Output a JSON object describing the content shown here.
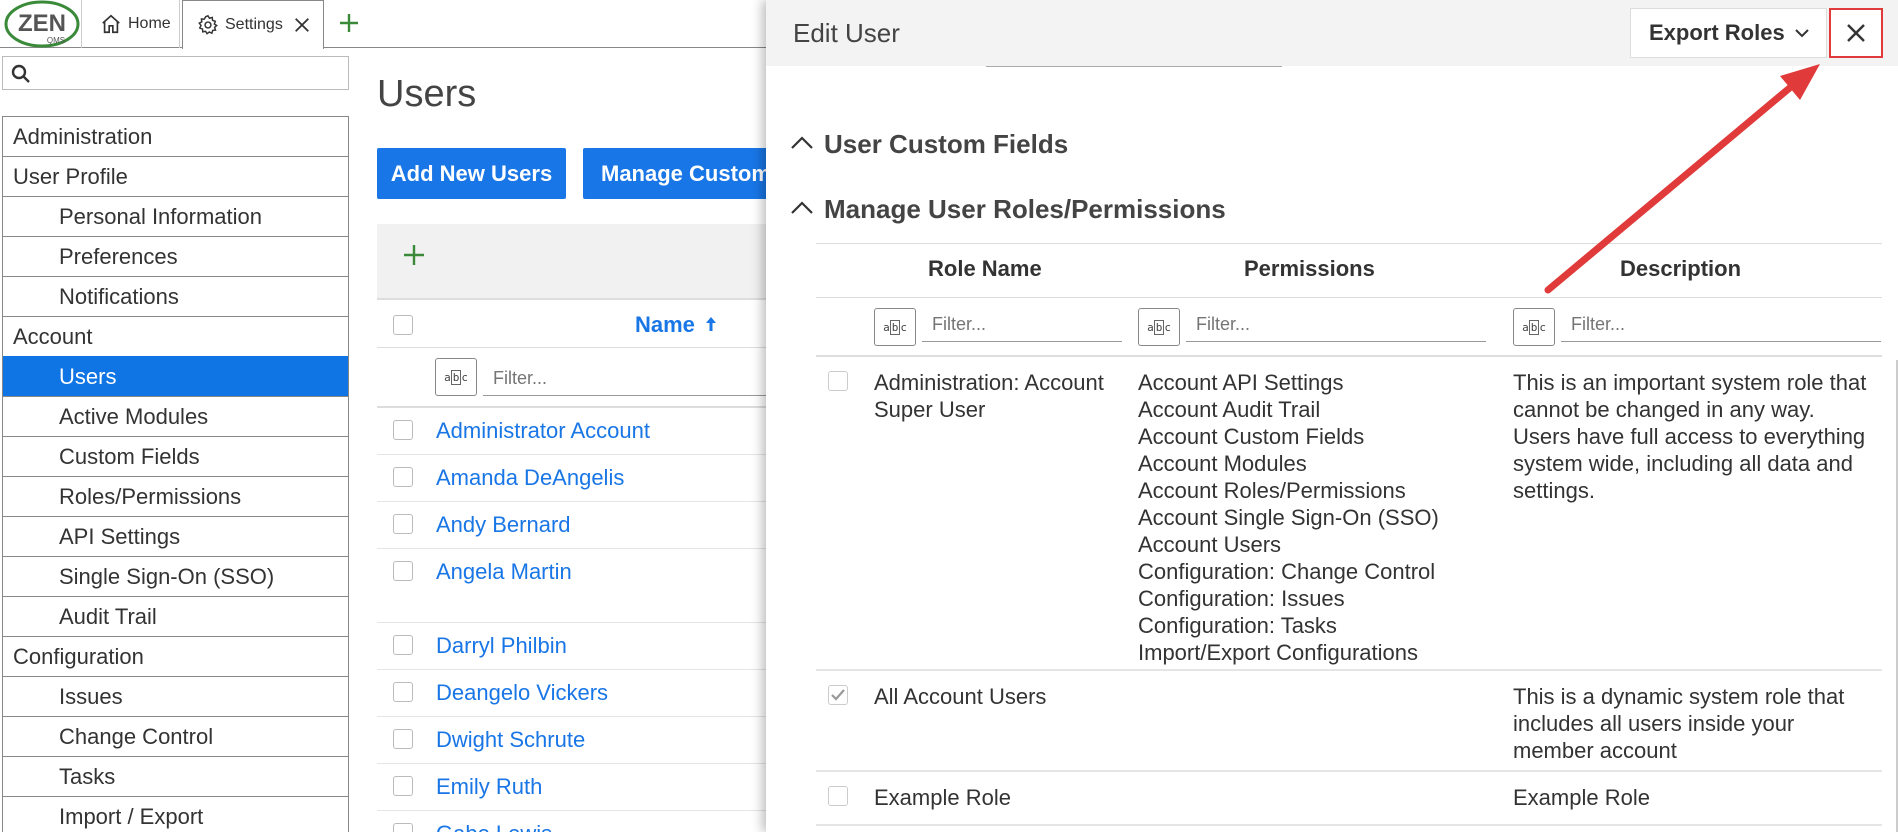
{
  "app": {
    "logo_text": "ZEN",
    "logo_sub": "QMS",
    "tabs": [
      {
        "label": "Home",
        "icon": "home-icon"
      },
      {
        "label": "Settings",
        "icon": "gear-icon"
      }
    ]
  },
  "sidebar": {
    "search_placeholder": "",
    "items": [
      {
        "label": "Administration",
        "level": "section"
      },
      {
        "label": "User Profile",
        "level": "section"
      },
      {
        "label": "Personal Information",
        "level": "child"
      },
      {
        "label": "Preferences",
        "level": "child"
      },
      {
        "label": "Notifications",
        "level": "child"
      },
      {
        "label": "Account",
        "level": "section"
      },
      {
        "label": "Users",
        "level": "child",
        "active": true
      },
      {
        "label": "Active Modules",
        "level": "child"
      },
      {
        "label": "Custom Fields",
        "level": "child"
      },
      {
        "label": "Roles/Permissions",
        "level": "child"
      },
      {
        "label": "API Settings",
        "level": "child"
      },
      {
        "label": "Single Sign-On (SSO)",
        "level": "child"
      },
      {
        "label": "Audit Trail",
        "level": "child"
      },
      {
        "label": "Configuration",
        "level": "section"
      },
      {
        "label": "Issues",
        "level": "child"
      },
      {
        "label": "Change Control",
        "level": "child"
      },
      {
        "label": "Tasks",
        "level": "child"
      },
      {
        "label": "Import / Export",
        "level": "child"
      }
    ]
  },
  "users_page": {
    "title": "Users",
    "add_button": "Add New Users",
    "manage_button": "Manage Custom",
    "name_column": "Name",
    "filter_placeholder": "Filter...",
    "users": [
      "Administrator Account",
      "Amanda DeAngelis",
      "Andy Bernard",
      "Angela Martin",
      "Darryl Philbin",
      "Deangelo Vickers",
      "Dwight Schrute",
      "Emily Ruth",
      "Gabe Lewis"
    ]
  },
  "edit_panel": {
    "title": "Edit User",
    "export_label": "Export Roles",
    "sections": {
      "custom_fields": "User Custom Fields",
      "roles": "Manage User Roles/Permissions"
    },
    "columns": {
      "role_name": "Role Name",
      "permissions": "Permissions",
      "description": "Description"
    },
    "filter_placeholder": "Filter...",
    "roles": [
      {
        "name": "Administration: Account Super User",
        "checked": false,
        "permissions": [
          "Account API Settings",
          "Account Audit Trail",
          "Account Custom Fields",
          "Account Modules",
          "Account Roles/Permissions",
          "Account Single Sign-On (SSO)",
          "Account Users",
          "Configuration: Change Control",
          "Configuration: Issues",
          "Configuration: Tasks",
          "Import/Export Configurations"
        ],
        "description": "This is an important system role that cannot be changed in any way. Users have full access to everything system wide, including all data and settings."
      },
      {
        "name": "All Account Users",
        "checked": true,
        "permissions": [],
        "description": "This is a dynamic system role that includes all users inside your member account"
      },
      {
        "name": "Example Role",
        "checked": false,
        "permissions": [],
        "description": "Example Role"
      }
    ]
  },
  "colors": {
    "primary": "#1976e6",
    "active_nav": "#0f74e4",
    "annotation": "#e03a3a",
    "logo_green": "#3a8a3a"
  }
}
